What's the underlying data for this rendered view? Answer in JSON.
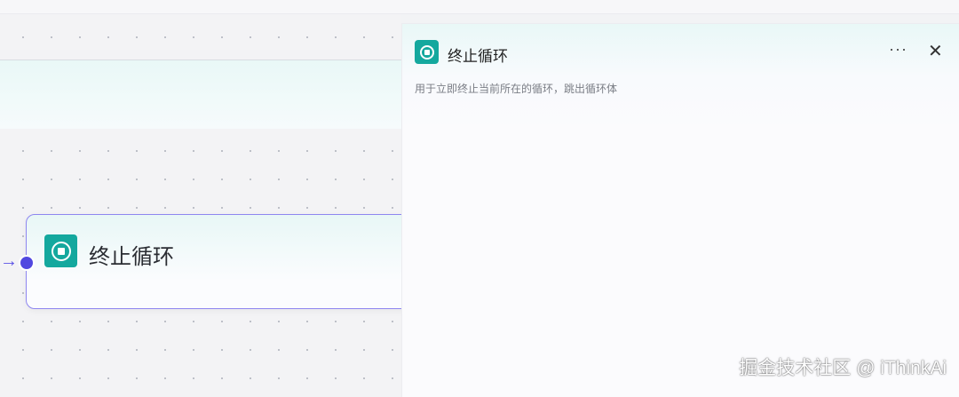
{
  "node": {
    "title": "终止循环",
    "icon": "stop-circle-icon"
  },
  "panel": {
    "title": "终止循环",
    "icon": "stop-circle-icon",
    "more_label": "···",
    "close_label": "✕",
    "description": "用于立即终止当前所在的循环，跳出循环体"
  },
  "watermark": "掘金技术社区 @ iThinkAi",
  "colors": {
    "accent": "#14a89e",
    "port": "#5148e0",
    "node_border": "#8e86f0"
  }
}
